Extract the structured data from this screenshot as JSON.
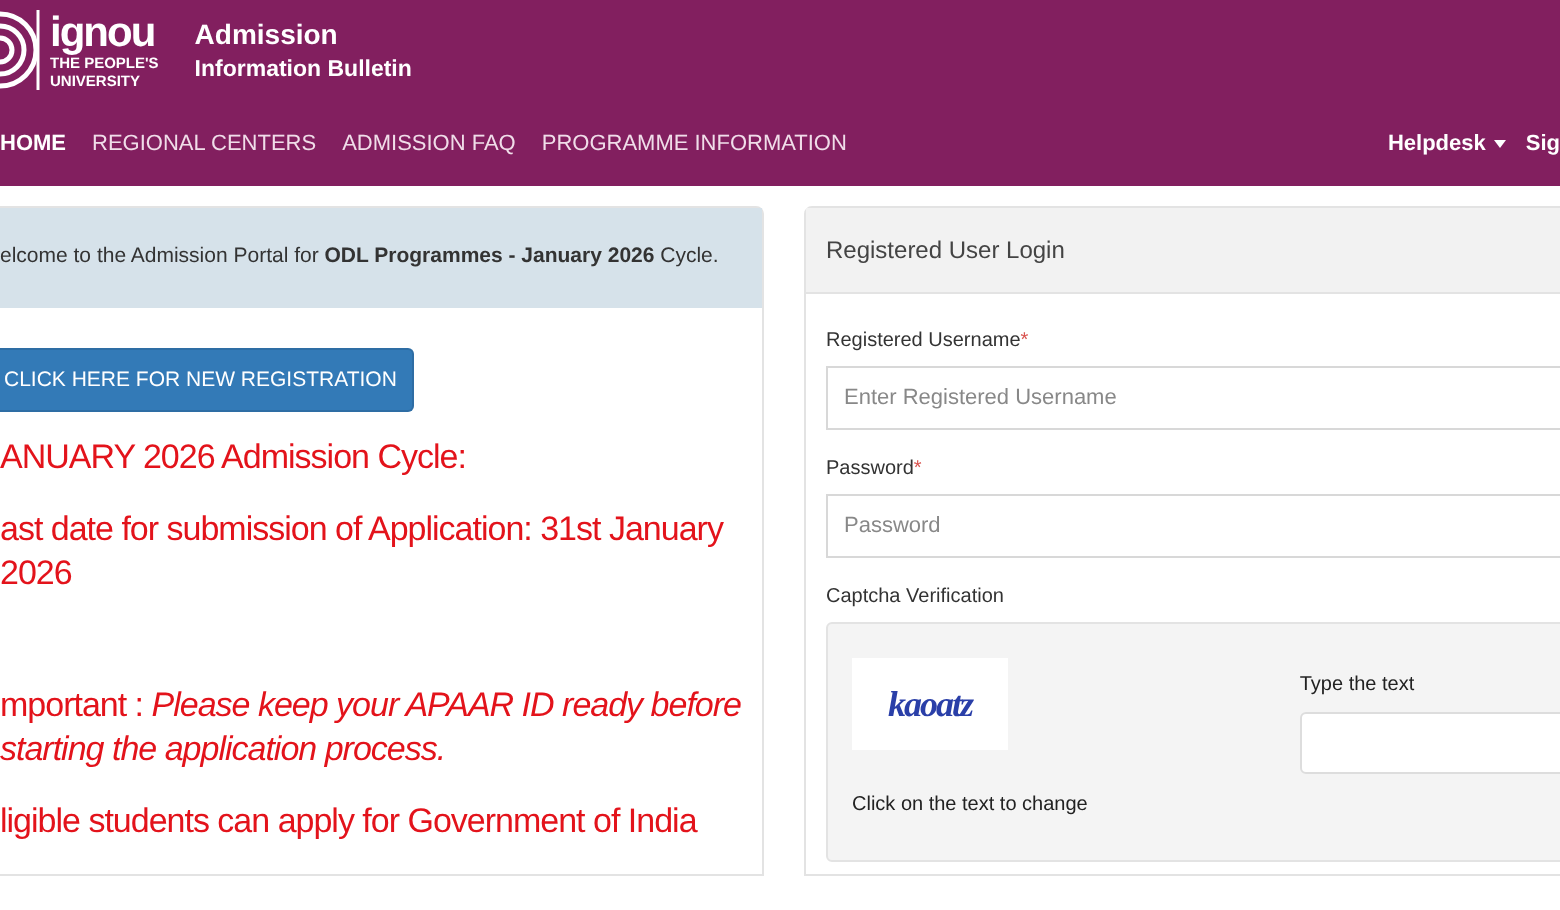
{
  "header": {
    "logo": {
      "name": "ignou",
      "tagline_1": "THE PEOPLE'S",
      "tagline_2": "UNIVERSITY"
    },
    "title": "Admission",
    "subtitle": "Information Bulletin"
  },
  "nav": {
    "items": [
      {
        "label": "HOME",
        "selected": true
      },
      {
        "label": "REGIONAL CENTERS",
        "selected": false
      },
      {
        "label": "ADMISSION FAQ",
        "selected": false
      },
      {
        "label": "PROGRAMME INFORMATION",
        "selected": false
      }
    ],
    "right": [
      {
        "label": "Helpdesk",
        "dropdown": true
      },
      {
        "label": "Sig",
        "dropdown": false
      }
    ]
  },
  "left_panel": {
    "welcome": "elcome to the Admission Portal for **ODL Programmes - January 2026** Cycle.",
    "button": "CLICK HERE FOR NEW REGISTRATION",
    "notices": [
      {
        "text": "ANUARY 2026 Admission Cycle:"
      },
      {
        "text": "ast date for submission of Application: 31st January 2026"
      },
      {
        "text": "mportant : *Please keep your APAAR ID ready before starting the application process.*"
      },
      {
        "text": "ligible students can apply for Government of India"
      }
    ]
  },
  "login": {
    "title": "Registered User Login",
    "fields": [
      {
        "label": "Registered Username",
        "required_mark": "*",
        "placeholder": "Enter Registered Username"
      },
      {
        "label": "Password",
        "required_mark": "*",
        "placeholder": "Password"
      }
    ],
    "captcha": {
      "label": "Captcha Verification",
      "image_text": "kaoatz",
      "hint": "Click on the text to change",
      "input_label": "Type the text"
    }
  }
}
